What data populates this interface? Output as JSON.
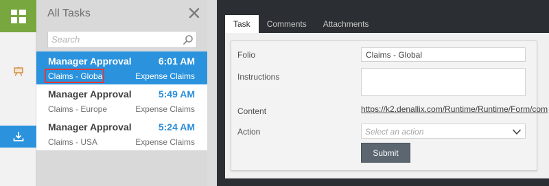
{
  "rail": {
    "logo_icon": "tiles-icon",
    "items": [
      {
        "icon": "easel-icon",
        "active": false
      },
      {
        "icon": "download-tray-icon",
        "active": true
      }
    ]
  },
  "task_list": {
    "title": "All Tasks",
    "search_placeholder": "Search",
    "tasks": [
      {
        "title": "Manager Approval",
        "time": "6:01 AM",
        "folio": "Claims - Global",
        "process": "Expense Claims",
        "selected": true
      },
      {
        "title": "Manager Approval",
        "time": "5:49 AM",
        "folio": "Claims - Europe",
        "process": "Expense Claims",
        "selected": false
      },
      {
        "title": "Manager Approval",
        "time": "5:24 AM",
        "folio": "Claims - USA",
        "process": "Expense Claims",
        "selected": false
      }
    ]
  },
  "panel": {
    "tabs": [
      {
        "label": "Task",
        "active": true
      },
      {
        "label": "Comments",
        "active": false
      },
      {
        "label": "Attachments",
        "active": false
      }
    ],
    "form": {
      "folio_label": "Folio",
      "folio_value": "Claims - Global",
      "instructions_label": "Instructions",
      "instructions_value": "",
      "content_label": "Content",
      "content_link": "https://k2.denallix.com/Runtime/Runtime/Form/com",
      "action_label": "Action",
      "action_placeholder": "Select an action",
      "submit_label": "Submit"
    }
  },
  "colors": {
    "accent_blue": "#2b93dd",
    "logo_green": "#78a740",
    "panel_dark": "#2b2f33",
    "highlight_red": "#e53935"
  }
}
